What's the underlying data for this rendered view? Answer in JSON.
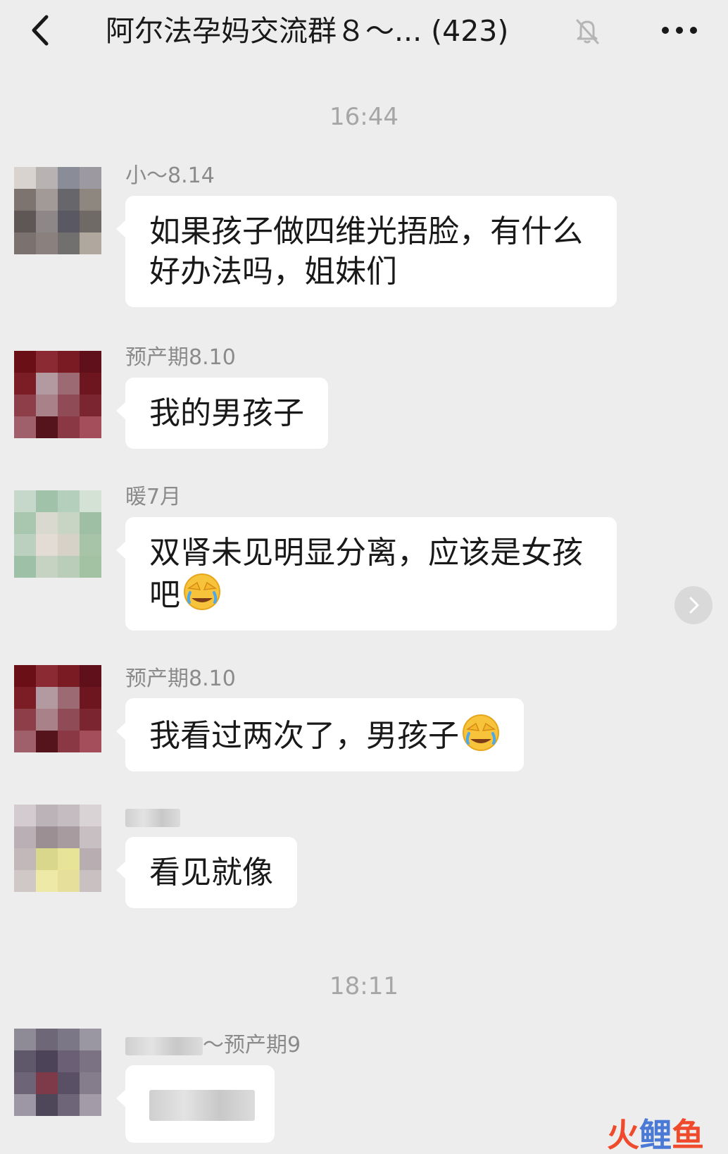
{
  "header": {
    "back_icon": "chevron-left-icon",
    "title": "阿尔法孕妈交流群８～... (423)",
    "mute_icon": "bell-off-icon",
    "more_icon": "ellipsis-icon"
  },
  "timestamps": [
    "16:44",
    "18:11"
  ],
  "messages": [
    {
      "sender": "小～8.14",
      "text": "如果孩子做四维光捂脸，有什么好办法吗，姐妹们"
    },
    {
      "sender": "预产期8.10",
      "text": "我的男孩子"
    },
    {
      "sender": "暖7月",
      "text": "双肾未见明显分离，应该是女孩吧"
    },
    {
      "sender": "预产期8.10",
      "text": "我看过两次了，男孩子"
    },
    {
      "sender": "",
      "text": "看见就像"
    },
    {
      "sender": "～预产期9",
      "text": ""
    }
  ],
  "emoji_name": "crying-laughing-facepalm-emoji",
  "side_button_icon": "chevron-right-icon",
  "watermark": {
    "part1": "火",
    "part2": "鲤",
    "part3": "鱼"
  },
  "colors": {
    "background": "#ededed",
    "bubble": "#ffffff",
    "timestamp": "#a6a6a6",
    "name": "#8b8b8b"
  }
}
